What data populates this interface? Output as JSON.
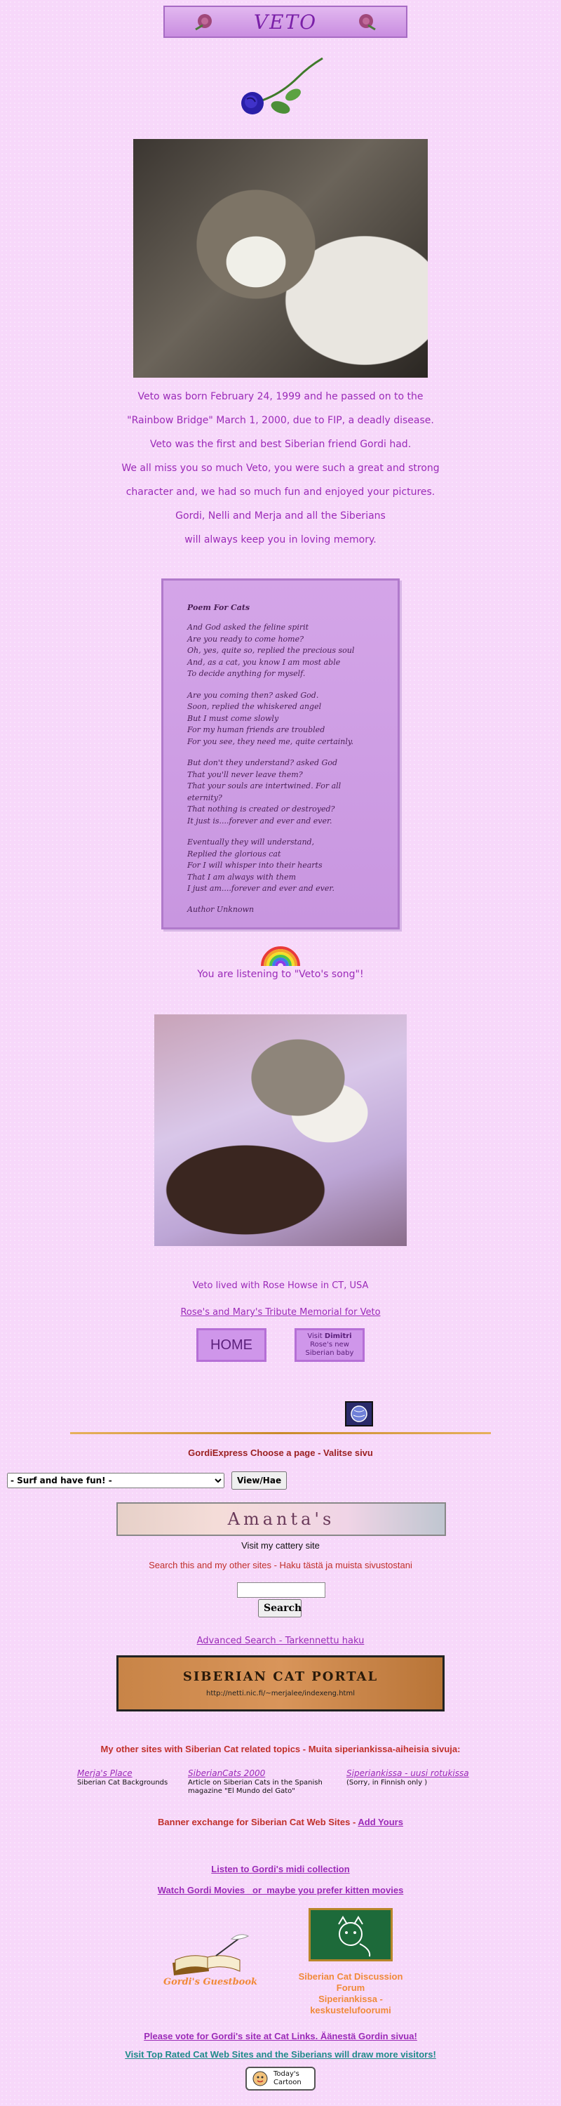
{
  "header": {
    "title": "VETO"
  },
  "bio": {
    "lines": [
      "Veto was born February 24, 1999 and he  passed on to the",
      "\"Rainbow Bridge\" March 1, 2000, due to FIP, a deadly disease.",
      "Veto was the first and best Siberian friend Gordi had.",
      "We all miss you so much Veto, you were such a great and strong",
      "character and, we had so much fun and enjoyed your  pictures.",
      "Gordi, Nelli and Merja and all the Siberians",
      "will always keep you in  loving memory."
    ]
  },
  "poem": {
    "title": "Poem For Cats",
    "stanzas": [
      "And God asked the feline spirit\nAre you ready to come home?\nOh, yes, quite so, replied the precious soul\nAnd, as a cat, you know I am most able\nTo decide anything for myself.",
      "Are you coming then? asked God.\nSoon, replied the whiskered angel\nBut I must come slowly\nFor my human friends are troubled\nFor you see, they need me, quite certainly.",
      "But don't they understand? asked God\nThat you'll never leave them?\nThat your souls are intertwined. For all eternity?\nThat nothing is created or destroyed?\nIt just is....forever and ever and ever.",
      "Eventually they will understand,\nReplied the glorious cat\nFor I will whisper into their hearts\nThat I am always with them\nI just am....forever and ever and ever."
    ],
    "author": "Author Unknown"
  },
  "song": {
    "text": "You are listening to \"Veto's song\"!"
  },
  "tribute": {
    "lived_text": "Veto lived with Rose Howse in CT, USA",
    "memorial_link": "Rose's and Mary's Tribute Memorial for Veto",
    "home_button": "HOME",
    "visit_button": {
      "line1": "Visit ",
      "name": "Dimitri",
      "line2": "Rose's new",
      "line3": "Siberian baby"
    }
  },
  "nav": {
    "choose_text": "GordiExpress Choose a page - Valitse sivu",
    "select_value": "- Surf and have fun! -",
    "view_button": "View/Hae"
  },
  "cattery": {
    "banner_text": "Amanta's",
    "caption": "Visit my cattery site"
  },
  "search": {
    "heading": "Search this and my other sites - Haku tästä ja muista sivustostani",
    "input_value": "",
    "button": "Search",
    "advanced_link": "Advanced Search - Tarkennettu haku"
  },
  "portal": {
    "title": "SIBERIAN CAT PORTAL",
    "url": "http://netti.nic.fi/~merjalee/indexeng.html"
  },
  "other_sites": {
    "heading": "My other sites with Siberian Cat related topics - Muita  siperiankissa-aiheisia sivuja:",
    "items": [
      {
        "link": "Merja's Place",
        "desc": "Siberian Cat Backgrounds"
      },
      {
        "link": "SiberianCats 2000",
        "desc": "Article on Siberian Cats in the Spanish magazine \"El Mundo del Gato\""
      },
      {
        "link": "Siperiankissa - uusi rotukissa",
        "desc": "(Sorry, in Finnish only )"
      }
    ]
  },
  "banner_exchange": {
    "text": "Banner exchange for Siberian Cat Web Sites - ",
    "link": "Add Yours"
  },
  "media": {
    "midi_link": "Listen to Gordi's midi collection",
    "movies_text": "Watch Gordi Movies   or  maybe you prefer kitten movies"
  },
  "guestbook": {
    "label": "Gordi's Guestbook"
  },
  "forum": {
    "line1": "Siberian Cat Discussion",
    "line2": "Forum",
    "line3": "Siperiankissa -",
    "line4": "keskustelufoorumi"
  },
  "vote": {
    "line1": "Please vote for Gordi's site at Cat Links. Äänestä Gordin sivua!",
    "line2": "Visit Top Rated Cat Web Sites and the Siberians will draw  more visitors!"
  },
  "cartoon": {
    "line1": "Today's",
    "line2": "Cartoon"
  },
  "colors": {
    "background": "#f7d8fa",
    "accent": "#9b2bb8",
    "heading_red": "#9a1f1f",
    "orange": "#e0853a"
  },
  "icons": [
    "rose-icon",
    "rainbow-icon",
    "globe-icon",
    "guestbook-icon",
    "forum-board-icon",
    "cartoon-icon"
  ]
}
